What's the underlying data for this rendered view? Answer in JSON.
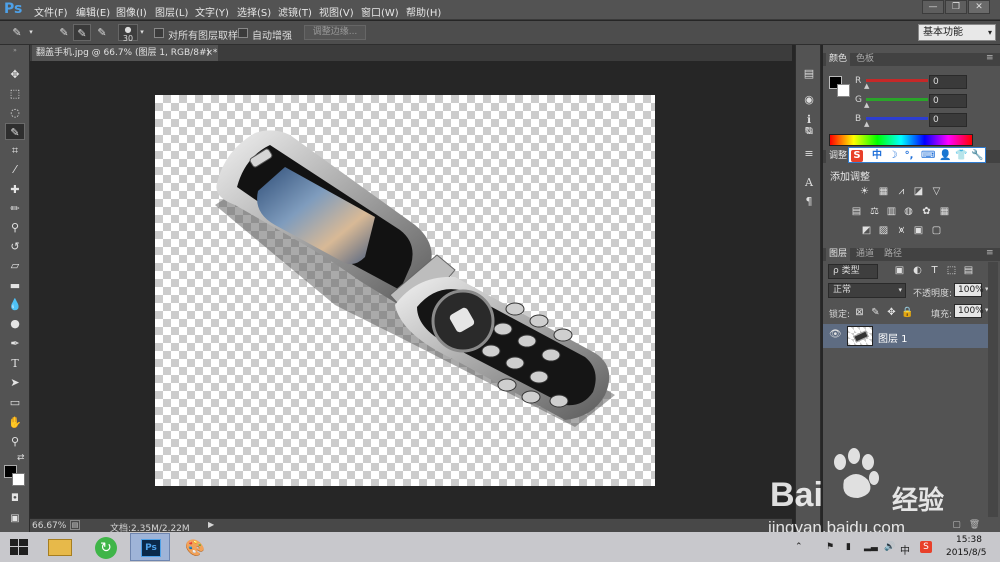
{
  "app": {
    "logo": "Ps"
  },
  "menu": [
    "文件(F)",
    "编辑(E)",
    "图像(I)",
    "图层(L)",
    "文字(Y)",
    "选择(S)",
    "滤镜(T)",
    "视图(V)",
    "窗口(W)",
    "帮助(H)"
  ],
  "window_controls": {
    "minimize": "—",
    "restore": "❐",
    "close": "✕"
  },
  "options": {
    "brush_size": "30",
    "sample_all_layers": "对所有图层取样",
    "auto_enhance": "自动增强",
    "refine_edge": "调整边缘...",
    "workspace": "基本功能"
  },
  "document_tab": {
    "title": "翻盖手机.jpg @ 66.7% (图层 1, RGB/8#) *",
    "close": "×"
  },
  "color_panel": {
    "tabs": [
      "颜色",
      "色板"
    ],
    "channels": [
      {
        "label": "R",
        "value": "0",
        "color": "#d62c2c"
      },
      {
        "label": "G",
        "value": "0",
        "color": "#2aa52a"
      },
      {
        "label": "B",
        "value": "0",
        "color": "#2d3ed0"
      }
    ]
  },
  "adjust_panel": {
    "tab": "调整",
    "title": "添加调整"
  },
  "ime": {
    "logo": "S",
    "items": [
      "中",
      "☽",
      "°,",
      "⌨",
      "👤",
      "👕",
      "🔧"
    ]
  },
  "layers_panel": {
    "tabs": [
      "图层",
      "通道",
      "路径"
    ],
    "filter": "ρ 类型",
    "blend_mode": "正常",
    "opacity_label": "不透明度:",
    "opacity_value": "100%",
    "lock_label": "锁定:",
    "fill_label": "填充:",
    "fill_value": "100%",
    "layers": [
      {
        "name": "图层 1",
        "visible": true
      }
    ]
  },
  "status": {
    "zoom": "66.67%",
    "doc_size": "文档:2.35M/2.22M"
  },
  "taskbar": {
    "time": "15:38",
    "date": "2015/8/5",
    "ime_indicator": "中"
  },
  "watermark": {
    "brand": "Bai",
    "brand2": "经验",
    "url": "jingyan.baidu.com"
  },
  "colors": {
    "accent": "#4ea1e8",
    "panel_bg": "#535353",
    "selected_layer": "#5e6c82"
  }
}
